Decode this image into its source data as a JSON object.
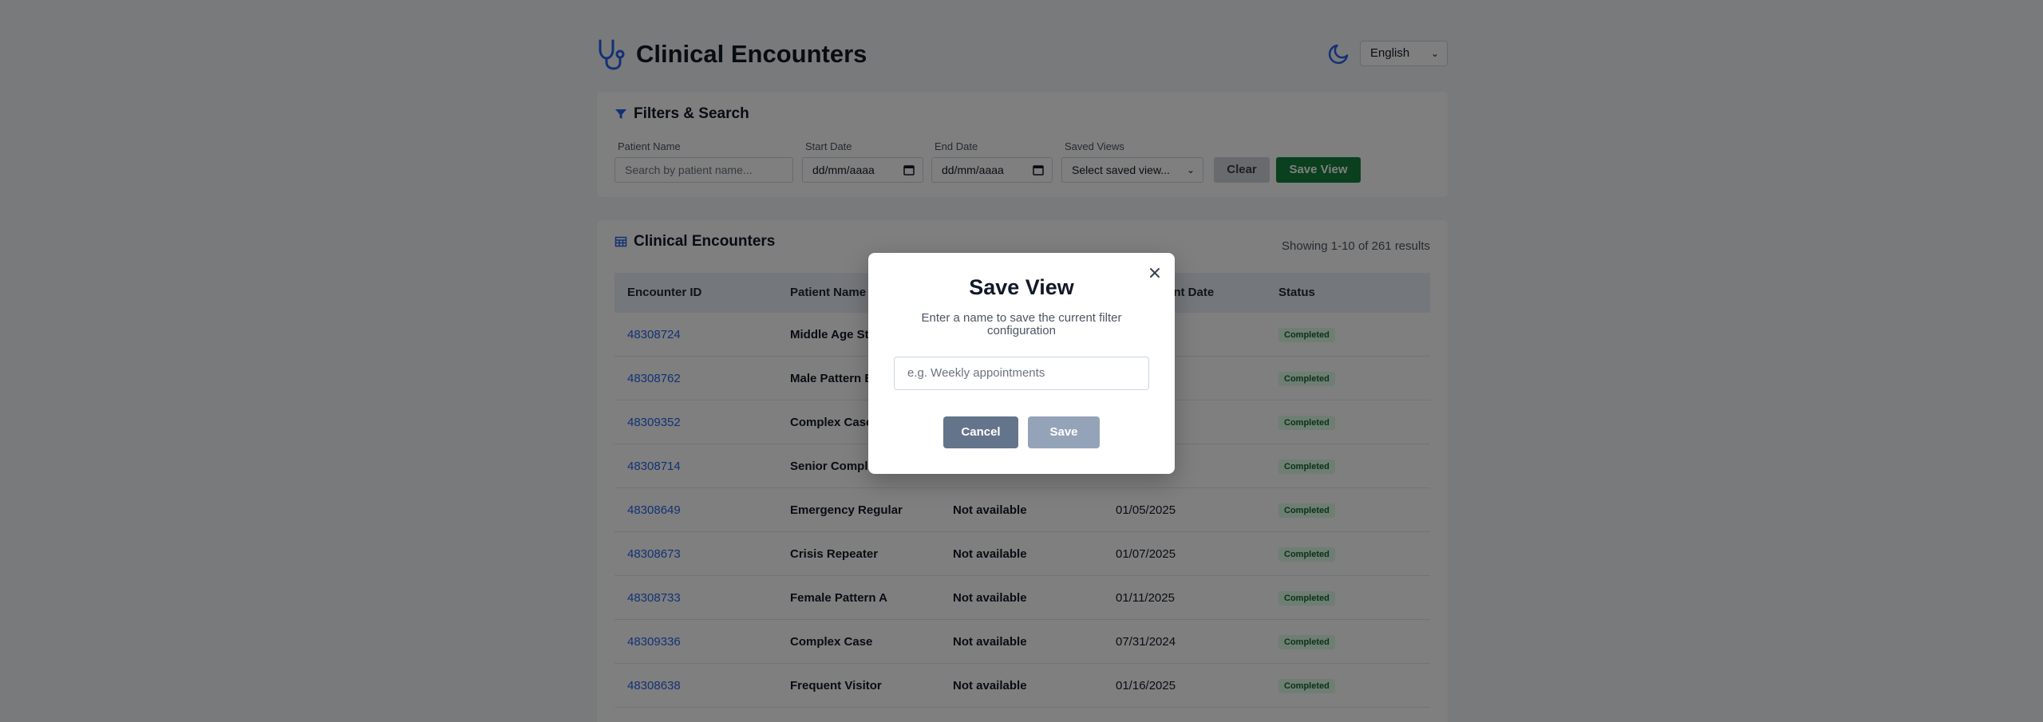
{
  "header": {
    "title": "Clinical Encounters",
    "language": "English",
    "icons": {
      "logo": "stethoscope-icon",
      "theme": "moon-icon"
    }
  },
  "filters": {
    "title": "Filters & Search",
    "patient_name_label": "Patient Name",
    "patient_name_placeholder": "Search by patient name...",
    "start_date_label": "Start Date",
    "start_date_value": "dd/mm/aaaa",
    "end_date_label": "End Date",
    "end_date_value": "dd/mm/aaaa",
    "saved_views_label": "Saved Views",
    "saved_views_value": "Select saved view...",
    "clear_label": "Clear",
    "save_view_label": "Save View"
  },
  "table": {
    "title": "Clinical Encounters",
    "results_text": "Showing 1-10 of 261 results",
    "columns": [
      "Encounter ID",
      "Patient Name",
      "",
      "ent Date",
      "Status"
    ],
    "rows": [
      {
        "id": "48308724",
        "name": "Middle Age St",
        "provider": "",
        "date": "",
        "status": "Completed"
      },
      {
        "id": "48308762",
        "name": "Male Pattern B",
        "provider": "",
        "date": "",
        "status": "Completed"
      },
      {
        "id": "48309352",
        "name": "Complex Case",
        "provider": "",
        "date": "",
        "status": "Completed"
      },
      {
        "id": "48308714",
        "name": "Senior Comple",
        "provider": "",
        "date": "",
        "status": "Completed"
      },
      {
        "id": "48308649",
        "name": "Emergency Regular",
        "provider": "Not available",
        "date": "01/05/2025",
        "status": "Completed"
      },
      {
        "id": "48308673",
        "name": "Crisis Repeater",
        "provider": "Not available",
        "date": "01/07/2025",
        "status": "Completed"
      },
      {
        "id": "48308733",
        "name": "Female Pattern A",
        "provider": "Not available",
        "date": "01/11/2025",
        "status": "Completed"
      },
      {
        "id": "48309336",
        "name": "Complex Case",
        "provider": "Not available",
        "date": "07/31/2024",
        "status": "Completed"
      },
      {
        "id": "48308638",
        "name": "Frequent Visitor",
        "provider": "Not available",
        "date": "01/16/2025",
        "status": "Completed"
      }
    ]
  },
  "modal": {
    "title": "Save View",
    "description": "Enter a name to save the current filter configuration",
    "input_placeholder": "e.g. Weekly appointments",
    "cancel_label": "Cancel",
    "save_label": "Save"
  },
  "colors": {
    "accent": "#2563eb",
    "save_view_button": "#15803d",
    "badge_bg": "#dcfce7",
    "badge_text": "#166534"
  }
}
